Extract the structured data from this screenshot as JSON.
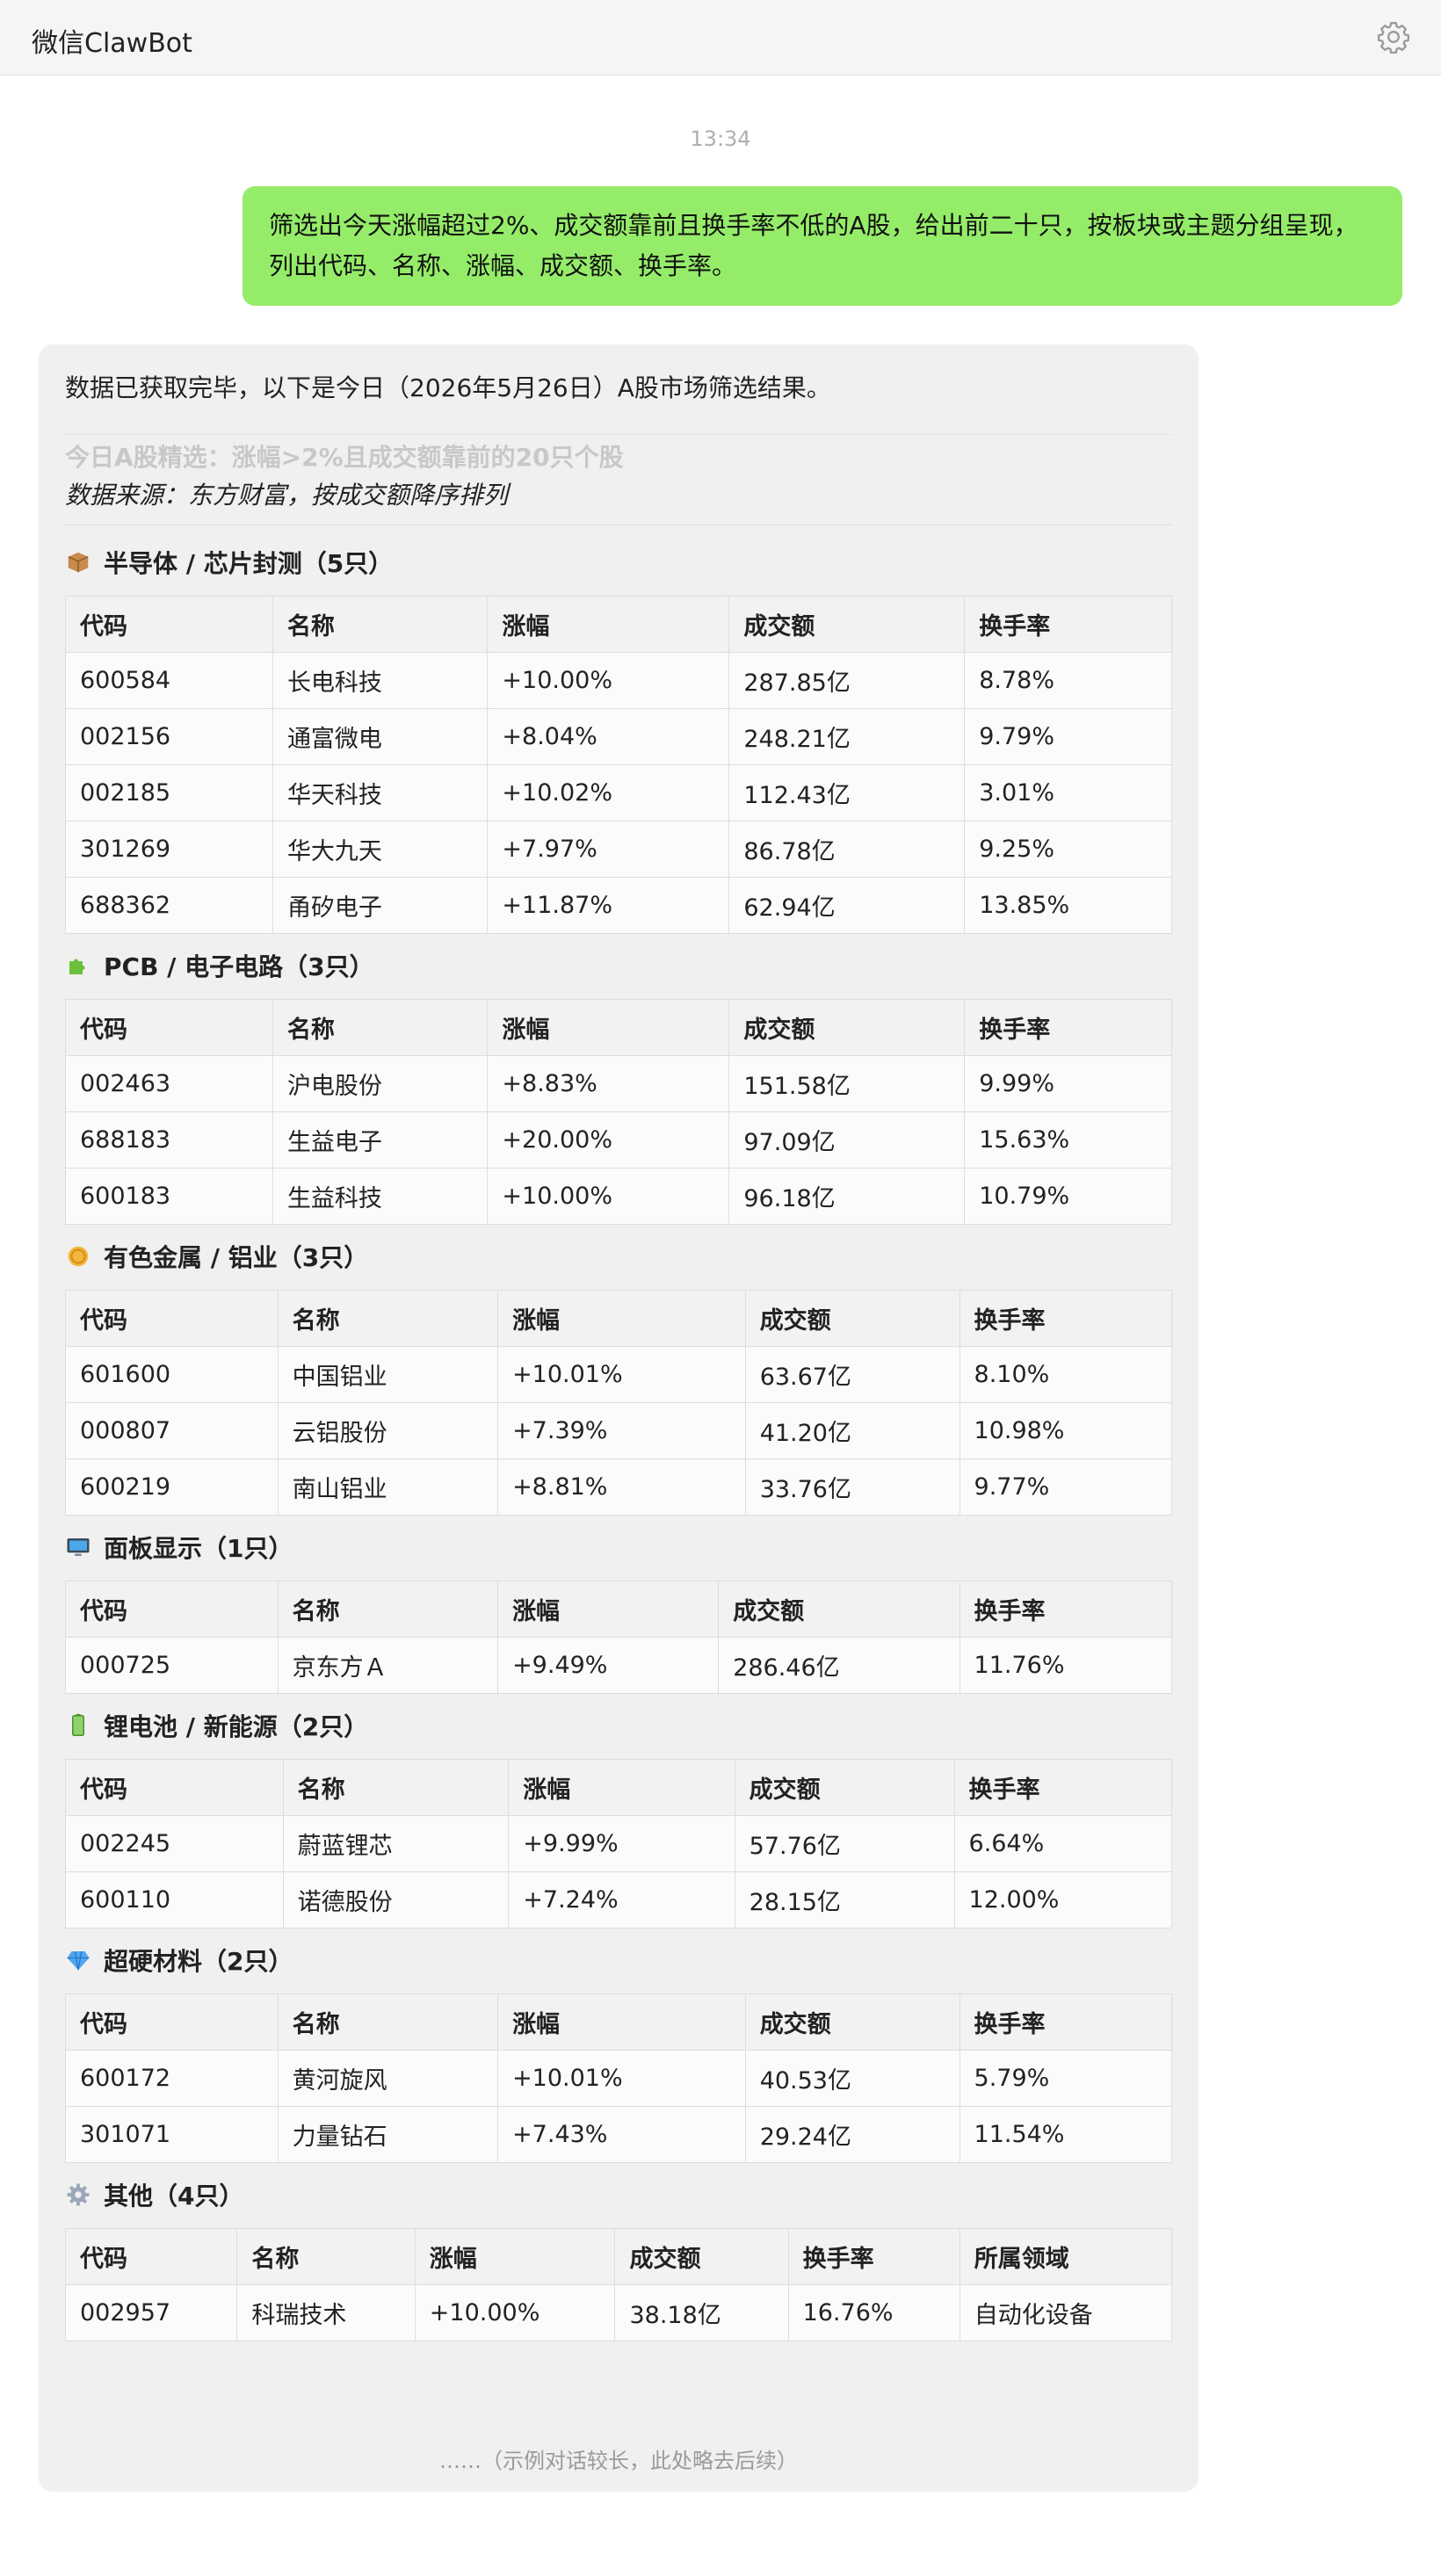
{
  "window": {
    "title": "微信ClawBot",
    "settings_icon": "gear-icon"
  },
  "timestamp": "13:34",
  "user_message": "筛选出今天涨幅超过2%、成交额靠前且换手率不低的A股，给出前二十只，按板块或主题分组呈现，列出代码、名称、涨幅、成交额、换手率。",
  "bot": {
    "intro": "数据已获取完毕，以下是今日（2026年5月26日）A股市场筛选结果。",
    "heading": "今日A股精选：涨幅>2%且成交额靠前的20只个股",
    "source": "数据来源：东方财富，按成交额降序排列",
    "columns": [
      "代码",
      "名称",
      "涨幅",
      "成交额",
      "换手率"
    ],
    "columns_other": [
      "代码",
      "名称",
      "涨幅",
      "成交额",
      "换手率",
      "所属领域"
    ],
    "sections": [
      {
        "title": "半导体 / 芯片封测（5只）",
        "icon": "package-icon",
        "rows": [
          [
            "600584",
            "长电科技",
            "+10.00%",
            "287.85亿",
            "8.78%"
          ],
          [
            "002156",
            "通富微电",
            "+8.04%",
            "248.21亿",
            "9.79%"
          ],
          [
            "002185",
            "华天科技",
            "+10.02%",
            "112.43亿",
            "3.01%"
          ],
          [
            "301269",
            "华大九天",
            "+7.97%",
            "86.78亿",
            "9.25%"
          ],
          [
            "688362",
            "甬矽电子",
            "+11.87%",
            "62.94亿",
            "13.85%"
          ]
        ]
      },
      {
        "title": "PCB / 电子电路（3只）",
        "icon": "puzzle-piece-icon",
        "rows": [
          [
            "002463",
            "沪电股份",
            "+8.83%",
            "151.58亿",
            "9.99%"
          ],
          [
            "688183",
            "生益电子",
            "+20.00%",
            "97.09亿",
            "15.63%"
          ],
          [
            "600183",
            "生益科技",
            "+10.00%",
            "96.18亿",
            "10.79%"
          ]
        ]
      },
      {
        "title": "有色金属 / 铝业（3只）",
        "icon": "coin-icon",
        "rows": [
          [
            "601600",
            "中国铝业",
            "+10.01%",
            "63.67亿",
            "8.10%"
          ],
          [
            "000807",
            "云铝股份",
            "+7.39%",
            "41.20亿",
            "10.98%"
          ],
          [
            "600219",
            "南山铝业",
            "+8.81%",
            "33.76亿",
            "9.77%"
          ]
        ]
      },
      {
        "title": "面板显示（1只）",
        "icon": "monitor-icon",
        "rows": [
          [
            "000725",
            "京东方Ａ",
            "+9.49%",
            "286.46亿",
            "11.76%"
          ]
        ]
      },
      {
        "title": "锂电池 / 新能源（2只）",
        "icon": "battery-icon",
        "rows": [
          [
            "002245",
            "蔚蓝锂芯",
            "+9.99%",
            "57.76亿",
            "6.64%"
          ],
          [
            "600110",
            "诺德股份",
            "+7.24%",
            "28.15亿",
            "12.00%"
          ]
        ]
      },
      {
        "title": "超硬材料（2只）",
        "icon": "gem-icon",
        "rows": [
          [
            "600172",
            "黄河旋风",
            "+10.01%",
            "40.53亿",
            "5.79%"
          ],
          [
            "301071",
            "力量钻石",
            "+7.43%",
            "29.24亿",
            "11.54%"
          ]
        ]
      },
      {
        "title": "其他（4只）",
        "icon": "gear-icon",
        "rows": [
          [
            "002957",
            "科瑞技术",
            "+10.00%",
            "38.18亿",
            "16.76%",
            "自动化设备"
          ]
        ]
      }
    ],
    "truncated_note": "……（示例对话较长，此处略去后续）"
  },
  "colors": {
    "user_bubble": "#95ec69",
    "bot_card": "#f0f0f0",
    "topbar": "#f5f5f5"
  }
}
